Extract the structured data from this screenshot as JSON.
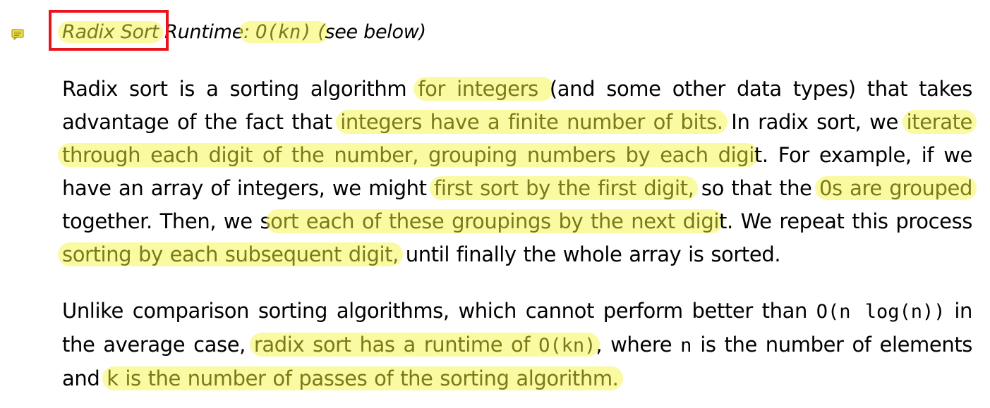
{
  "note": {
    "title": "Radix Sort",
    "runtime_label": "Runtime",
    "runtime_colon": ":",
    "runtime_value": "O(kn)",
    "runtime_paren": "(",
    "runtime_suffix": "see below)"
  },
  "paragraph1": {
    "s1": "Radix sort is a sorting algorithm ",
    "h1": "for integers ",
    "s2": "(and some other data types) that takes advantage of the fact that ",
    "h2": "integers have a finite number of bits.",
    "s3": " In radix sort, we ",
    "h3": "iterate through each digit of the number, grouping numbers by each digi",
    "h3b": "t",
    "s4": ". For example, if we have an array of integers, we might ",
    "h4": "first sort by the first digit,",
    "s5": " so that the ",
    "h5": "0s are grouped",
    "s6": " together. Then, we s",
    "h6": "ort each of these groupings by the next digi",
    "h6b": "t",
    "s7": ". We repeat this process ",
    "h7": "sorting by each subsequent digit,",
    "s8": " until finally the whole array is sorted."
  },
  "paragraph2": {
    "s1": "Unlike comparison sorting algorithms, which cannot perform better than ",
    "m1": "O(n log(n))",
    "s2": " in the average case, ",
    "h1": "radix sort has a runtime of ",
    "m2": "O(kn)",
    "s3": ", where ",
    "m3": "n",
    "s4": " is the number of elements and ",
    "h2": "k is the number of passes of the sorting algorithm."
  },
  "colors": {
    "highlight": "#f6f658",
    "highlight_text": "#7a7a18",
    "title_box_border": "#e8141b",
    "note_icon": "#f0e040"
  },
  "icons": {
    "note": "note-icon"
  }
}
